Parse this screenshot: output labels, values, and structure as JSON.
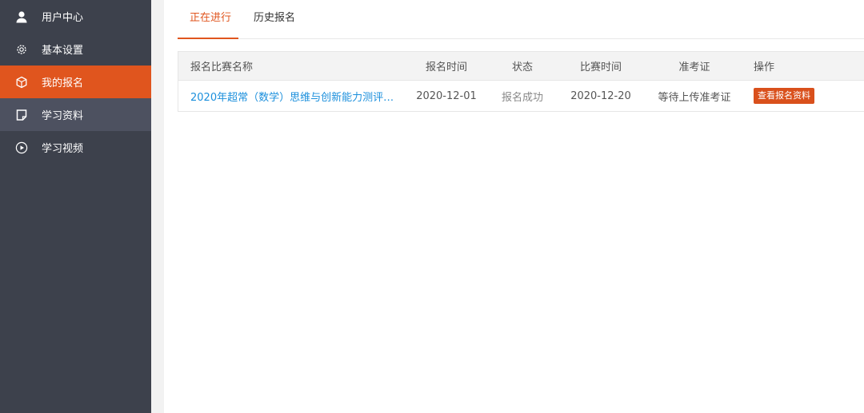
{
  "sidebar": {
    "items": [
      {
        "label": "用户中心",
        "icon": "user-icon"
      },
      {
        "label": "基本设置",
        "icon": "gear-icon"
      },
      {
        "label": "我的报名",
        "icon": "box-icon"
      },
      {
        "label": "学习资料",
        "icon": "document-icon"
      },
      {
        "label": "学习视频",
        "icon": "play-circle-icon"
      }
    ],
    "active_index": 2
  },
  "tabs": [
    {
      "label": "正在进行"
    },
    {
      "label": "历史报名"
    }
  ],
  "table": {
    "headers": {
      "name": "报名比赛名称",
      "signup_time": "报名时间",
      "status": "状态",
      "contest_time": "比赛时间",
      "ticket": "准考证",
      "action": "操作"
    },
    "rows": [
      {
        "name": "2020年超常（数学）思维与创新能力测评…",
        "signup_time": "2020-12-01",
        "status": "报名成功",
        "contest_time": "2020-12-20",
        "ticket": "等待上传准考证",
        "action": "查看报名资料"
      }
    ]
  },
  "colors": {
    "accent": "#e0551e",
    "sidebar_bg": "#3d414c",
    "link": "#1b8fdc"
  }
}
